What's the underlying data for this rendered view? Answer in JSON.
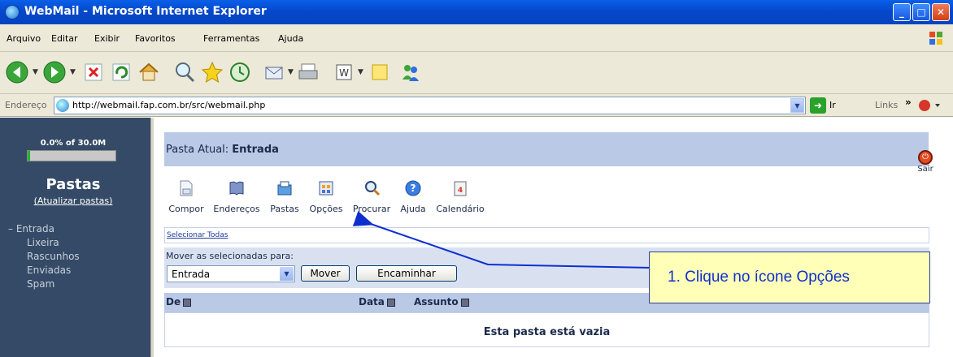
{
  "window": {
    "title": "WebMail - Microsoft Internet Explorer"
  },
  "menu": [
    "Arquivo",
    "Editar",
    "Exibir",
    "Favoritos",
    "Ferramentas",
    "Ajuda"
  ],
  "address": {
    "label": "Endereço",
    "url": "http://webmail.fap.com.br/src/webmail.php",
    "go_label": "Ir",
    "links_label": "Links"
  },
  "sidebar": {
    "quota_text": "0.0% of 30.0M",
    "quota_percent": 0.0,
    "title": "Pastas",
    "update_link": "(Atualizar pastas)",
    "folders": [
      "– Entrada",
      "Lixeira",
      "Rascunhos",
      "Enviadas",
      "Spam"
    ]
  },
  "main": {
    "current_folder_label": "Pasta Atual:",
    "current_folder_name": "Entrada",
    "logout_label": "Sair",
    "tools": [
      "Compor",
      "Endereços",
      "Pastas",
      "Opções",
      "Procurar",
      "Ajuda",
      "Calendário"
    ],
    "select_all": "Selecionar Todas",
    "move_label": "Mover as selecionadas para:",
    "move_folder": "Entrada",
    "move_button": "Mover",
    "forward_button": "Encaminhar",
    "columns": {
      "from": "De",
      "date": "Data",
      "subject": "Assunto"
    },
    "empty_message": "Esta pasta está vazia"
  },
  "callout": {
    "text": "1. Clique no ícone Opções"
  },
  "colors": {
    "sidebar_bg": "#344a66",
    "header_bg": "#b9c9e6",
    "callout_text": "#0e2fd0"
  }
}
